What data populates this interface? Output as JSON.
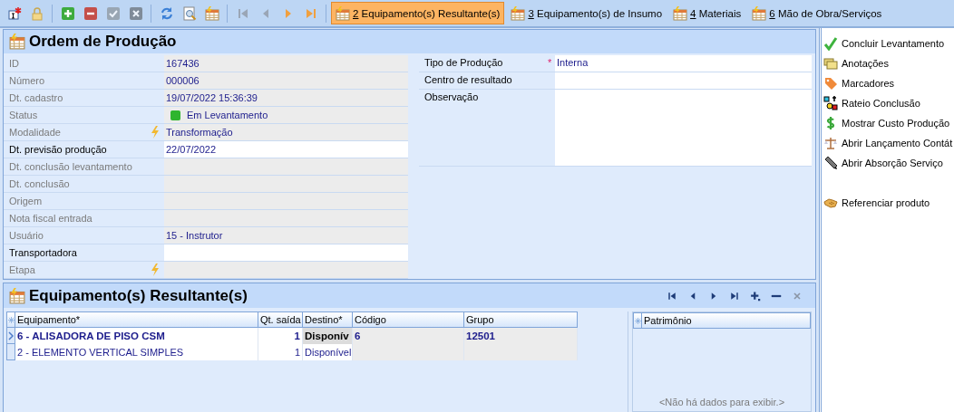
{
  "toolbar": {
    "buttons": [
      {
        "kind": "new",
        "disabled": false
      },
      {
        "kind": "lock",
        "disabled": false
      },
      {
        "kind": "add",
        "disabled": false
      },
      {
        "kind": "remove",
        "disabled": false
      },
      {
        "kind": "confirm",
        "disabled": true
      },
      {
        "kind": "cancel",
        "disabled": true
      },
      {
        "kind": "refresh",
        "disabled": false
      },
      {
        "kind": "preview",
        "disabled": false
      },
      {
        "kind": "grid",
        "disabled": false
      },
      {
        "kind": "first",
        "disabled": true
      },
      {
        "kind": "prev",
        "disabled": true
      },
      {
        "kind": "next",
        "disabled": false
      },
      {
        "kind": "last",
        "disabled": false
      }
    ]
  },
  "tabs": [
    {
      "key": "2",
      "label": "Equipamento(s) Resultante(s)",
      "selected": true
    },
    {
      "key": "3",
      "label": "Equipamento(s) de Insumo",
      "selected": false
    },
    {
      "key": "4",
      "label": "Materiais",
      "selected": false
    },
    {
      "key": "6",
      "label": "Mão de Obra/Serviços",
      "selected": false
    }
  ],
  "form": {
    "title": "Ordem de Produção",
    "left_fields": [
      {
        "label": "ID",
        "value": "167436",
        "editable": false,
        "lookup": false
      },
      {
        "label": "Número",
        "value": "000006",
        "editable": false,
        "lookup": false
      },
      {
        "label": "Dt. cadastro",
        "value": "19/07/2022 15:36:39",
        "editable": false,
        "lookup": false
      },
      {
        "label": "Status",
        "value": "Em Levantamento",
        "editable": false,
        "lookup": false,
        "color": "#2fb52f"
      },
      {
        "label": "Modalidade",
        "value": "Transformação",
        "editable": false,
        "lookup": true
      },
      {
        "label": "Dt. previsão produção",
        "value": "22/07/2022",
        "editable": true,
        "lookup": false
      },
      {
        "label": "Dt. conclusão levantamento",
        "editable": false,
        "lookup": false
      },
      {
        "label": "Dt. conclusão",
        "editable": false,
        "lookup": false
      },
      {
        "label": "Origem",
        "editable": false,
        "lookup": false
      },
      {
        "label": "Nota fiscal entrada",
        "editable": false,
        "lookup": false
      },
      {
        "label": "Usuário",
        "value": "15 - Instrutor",
        "editable": false,
        "lookup": false
      },
      {
        "label": "Transportadora",
        "editable": true,
        "lookup": false
      },
      {
        "label": "Etapa",
        "editable": false,
        "lookup": true
      }
    ],
    "right_fields": [
      {
        "kind": "text",
        "label": "Tipo de Produção",
        "value": "Interna",
        "required_mark": "*"
      },
      {
        "kind": "text",
        "label": "Centro de resultado"
      },
      {
        "kind": "memo",
        "label": "Observação"
      }
    ]
  },
  "actions": [
    {
      "kind": "check",
      "label": "Concluir Levantamento"
    },
    {
      "kind": "notes",
      "label": "Anotações"
    },
    {
      "kind": "tag",
      "label": "Marcadores"
    },
    {
      "kind": "shapes",
      "label": "Rateio Conclusão"
    },
    {
      "kind": "dollar",
      "label": "Mostrar Custo Produção"
    },
    {
      "kind": "scale",
      "label": "Abrir Lançamento Contát"
    },
    {
      "kind": "pen",
      "label": "Abrir Absorção Serviço"
    }
  ],
  "extra_actions": [
    {
      "kind": "hand",
      "label": "Referenciar produto"
    }
  ],
  "items_panel": {
    "title": "Equipamento(s) Resultante(s)",
    "nav": [
      {
        "kind": "first",
        "disabled": false
      },
      {
        "kind": "prev",
        "disabled": false
      },
      {
        "kind": "next",
        "disabled": false
      },
      {
        "kind": "last",
        "disabled": false
      },
      {
        "kind": "add",
        "disabled": false
      },
      {
        "kind": "remove",
        "disabled": false
      },
      {
        "kind": "delete",
        "disabled": true
      }
    ],
    "grid": {
      "columns": [
        {
          "label": "Equipamento*",
          "kind": "text",
          "readonly": false
        },
        {
          "label": "Qt. saída",
          "kind": "number",
          "readonly": false
        },
        {
          "label": "Destino*",
          "kind": "text",
          "readonly": false
        },
        {
          "label": "Código",
          "kind": "text",
          "readonly": true
        },
        {
          "label": "Grupo",
          "kind": "text",
          "readonly": true
        }
      ],
      "rows": [
        {
          "selected": true,
          "cells": [
            {
              "text": "6 - ALISADORA DE PISO CSM",
              "focused": false
            },
            {
              "text": "1",
              "focused": false
            },
            {
              "text": "Disponív",
              "focused": true
            },
            {
              "text": "6",
              "focused": false
            },
            {
              "text": "12501",
              "focused": false
            }
          ]
        },
        {
          "selected": false,
          "cells": [
            {
              "text": "2 - ELEMENTO VERTICAL SIMPLES",
              "focused": false
            },
            {
              "text": "1",
              "focused": false
            },
            {
              "text": "Disponível",
              "focused": false
            },
            {
              "focused": false
            },
            {
              "focused": false
            }
          ]
        }
      ]
    },
    "asset_grid": {
      "columns": [
        {
          "label": "Patrimônio"
        }
      ],
      "empty_text": "<Não há dados para exibir.>"
    }
  }
}
